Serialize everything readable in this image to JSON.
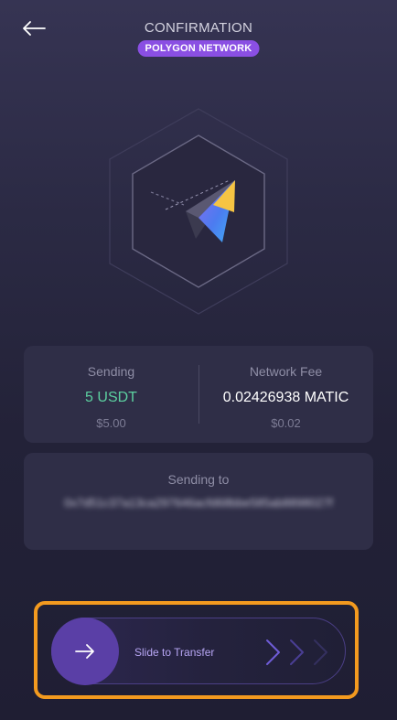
{
  "header": {
    "back_icon": "arrow-left-icon",
    "title": "CONFIRMATION",
    "network_badge": "POLYGON NETWORK"
  },
  "illustration": {
    "icon": "paper-plane-icon"
  },
  "transfer_summary": {
    "sending_label": "Sending",
    "sending_amount": "5 USDT",
    "sending_fiat": "$5.00",
    "fee_label": "Network Fee",
    "fee_amount": "0.02426938 MATIC",
    "fee_fiat": "$0.02"
  },
  "recipient": {
    "label": "Sending to",
    "address": "0x7d51c37a13ca297646acfd68bbe585ab8898027f"
  },
  "slider": {
    "knob_icon": "arrow-right-icon",
    "label": "Slide to Transfer",
    "chevrons_icon": "chevron-right-icon"
  },
  "colors": {
    "accent_purple": "#8a4fe3",
    "amount_green": "#5cd0a0",
    "highlight_orange": "#f39a1f",
    "knob_purple": "#5a3fa6"
  }
}
